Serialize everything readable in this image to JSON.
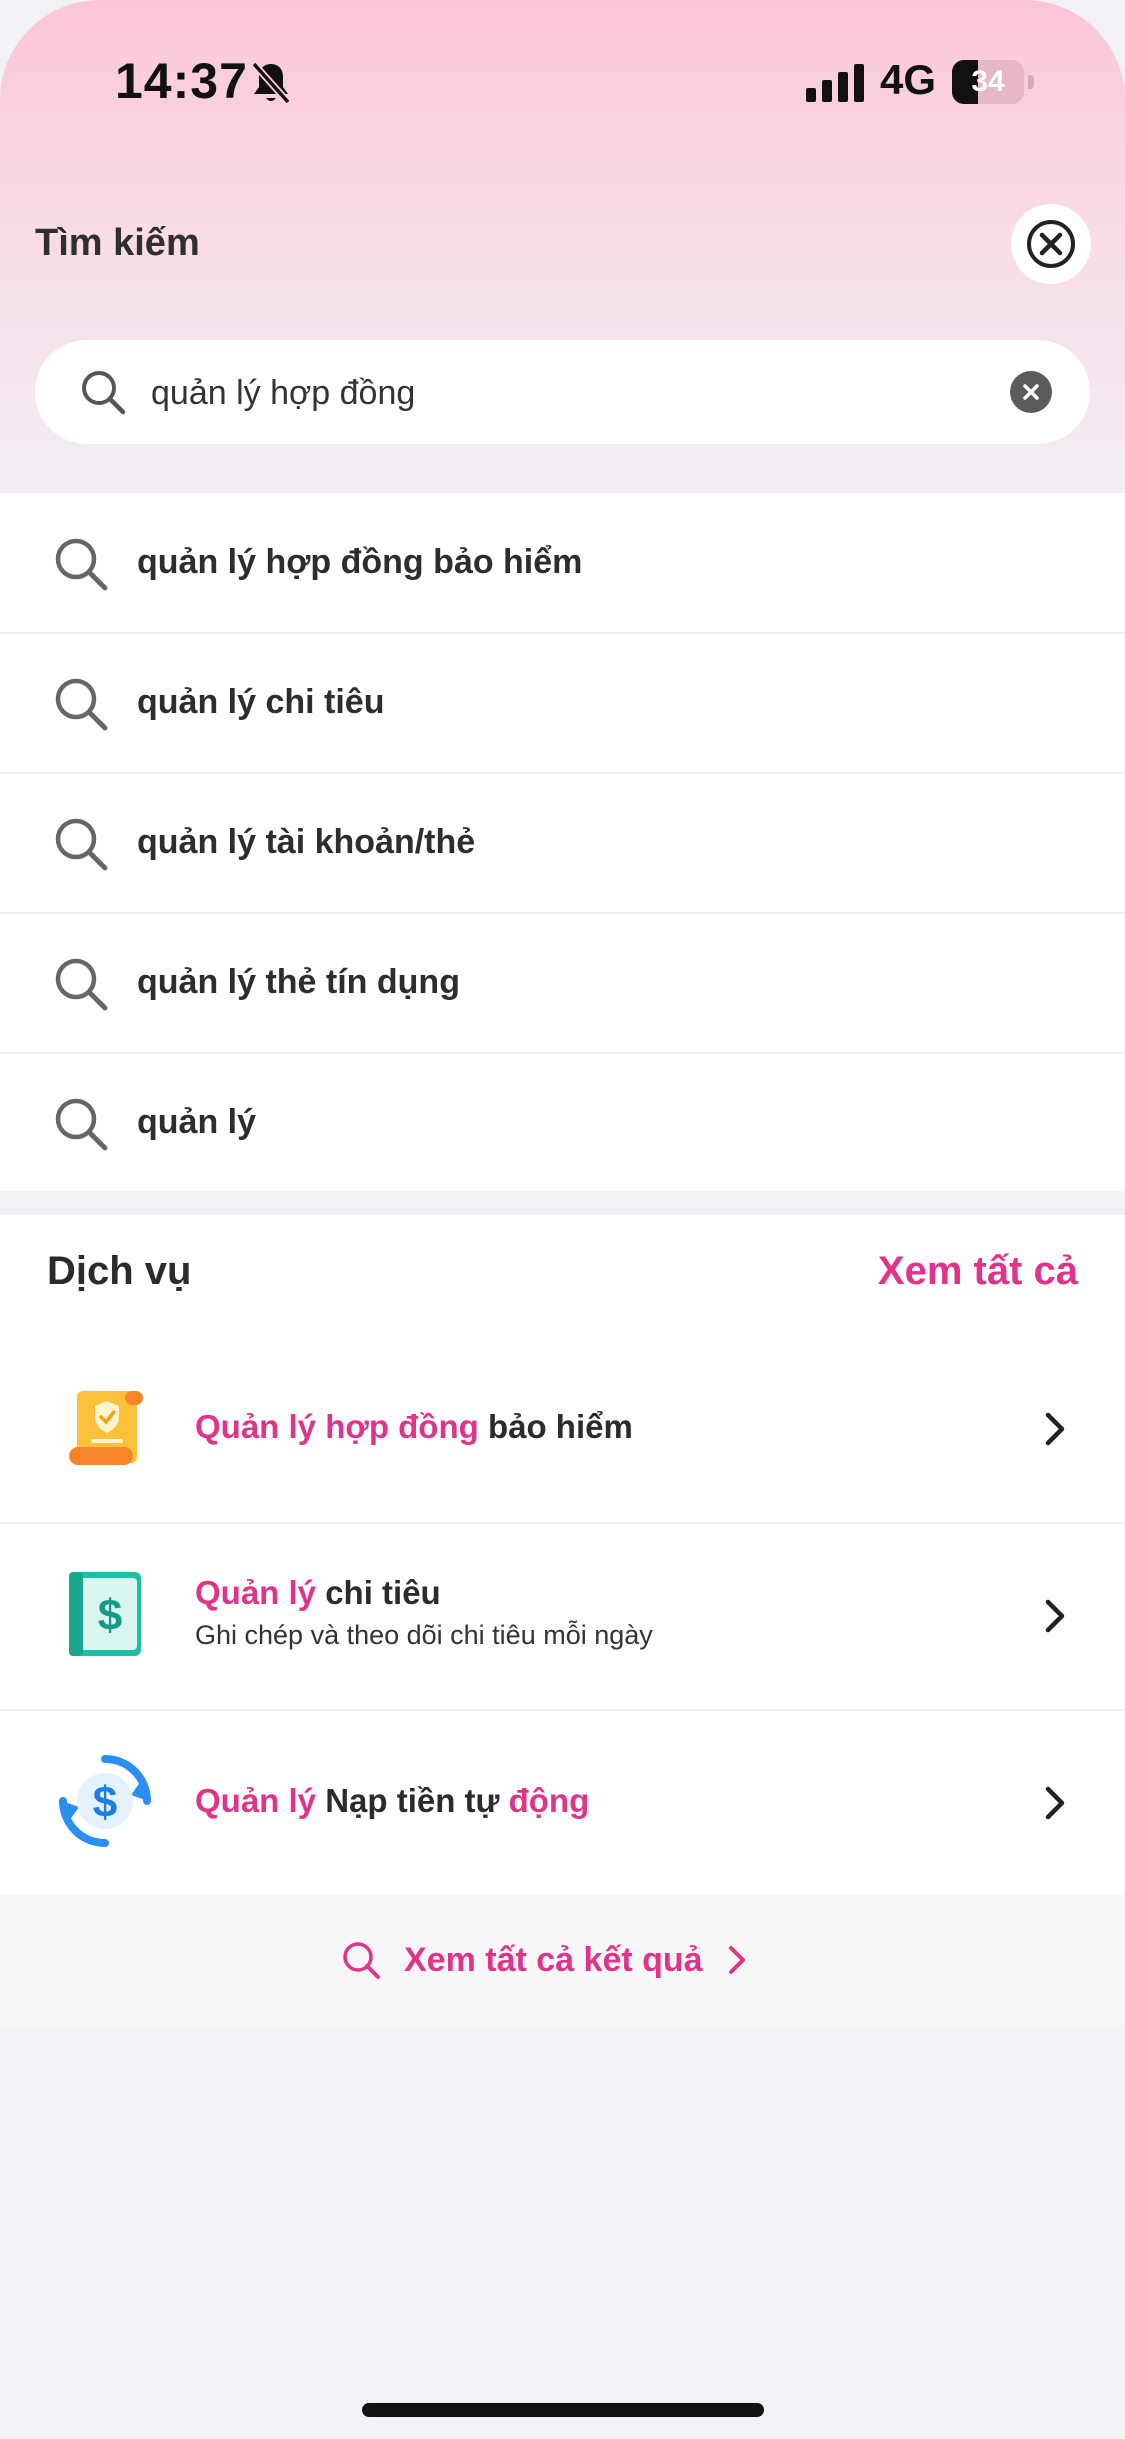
{
  "status_bar": {
    "time": "14:37",
    "network": "4G",
    "battery": "34",
    "icons": [
      "bell-slash-icon",
      "signal-icon",
      "battery-icon"
    ]
  },
  "header": {
    "title": "Tìm kiếm",
    "close_icon": "close-circle-icon"
  },
  "search": {
    "value": "quản lý hợp đồng",
    "placeholder": ""
  },
  "suggestions": [
    {
      "text": "quản lý hợp đồng bảo hiểm"
    },
    {
      "text": "quản lý chi tiêu"
    },
    {
      "text": "quản lý tài khoản/thẻ"
    },
    {
      "text": "quản lý thẻ tín dụng"
    },
    {
      "text": "quản lý"
    }
  ],
  "services": {
    "heading": "Dịch vụ",
    "see_all": "Xem tất cả",
    "items": [
      {
        "highlight": "Quản lý hợp đồng",
        "rest": " bảo hiểm",
        "subtitle": "",
        "icon": "insurance-scroll-icon"
      },
      {
        "highlight": "Quản lý",
        "rest": " chi tiêu",
        "subtitle": "Ghi chép và theo dõi chi tiêu mỗi ngày",
        "icon": "expense-book-icon"
      },
      {
        "highlight": "Quản lý",
        "rest": " Nạp tiền tự ",
        "highlight2": "động",
        "subtitle": "",
        "icon": "auto-topup-icon"
      }
    ]
  },
  "see_all_results": "Xem tất cả kết quả",
  "colors": {
    "accent": "#e0348a",
    "gradient_top": "#fbc6d8",
    "background": "#f1f1f6"
  }
}
